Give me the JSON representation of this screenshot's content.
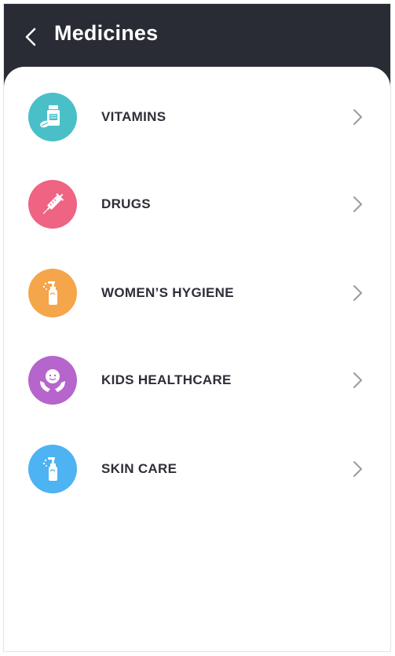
{
  "header": {
    "title": "Medicines",
    "background": "#2a2c35",
    "back_icon": "chevron-left-icon"
  },
  "categories": [
    {
      "label": "VITAMINS",
      "icon": "vitamin-bottle-icon",
      "color": "#4bbfc8"
    },
    {
      "label": "DRUGS",
      "icon": "syringe-icon",
      "color": "#ef6383"
    },
    {
      "label": "WOMEN’S HYGIENE",
      "icon": "spray-bottle-icon",
      "color": "#f5a54a"
    },
    {
      "label": "KIDS HEALTHCARE",
      "icon": "baby-hands-icon",
      "color": "#b665cc"
    },
    {
      "label": "SKIN CARE",
      "icon": "lotion-bottle-icon",
      "color": "#4db3f2"
    }
  ],
  "row_chevron_icon": "chevron-right-icon"
}
